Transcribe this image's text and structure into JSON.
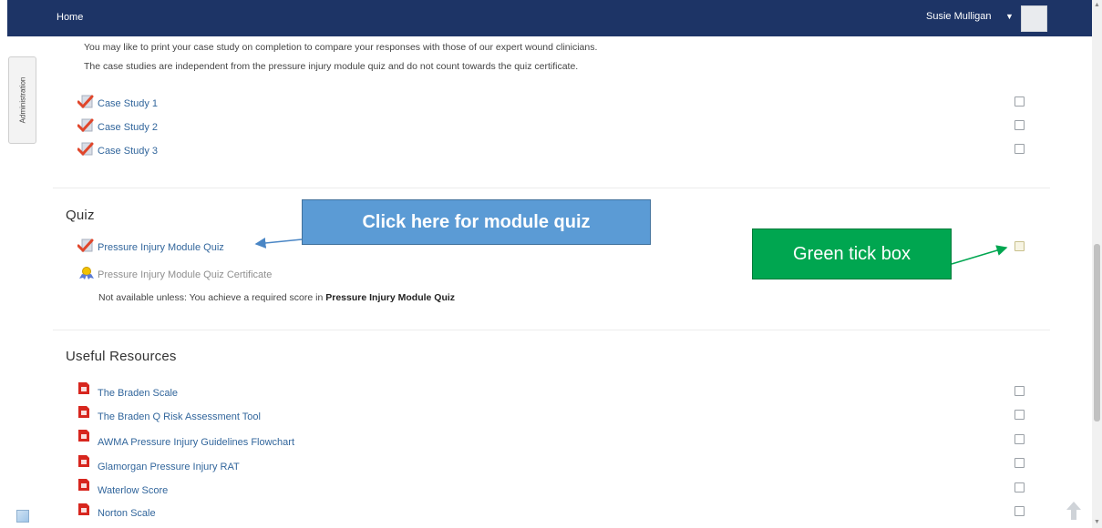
{
  "nav": {
    "home": "Home",
    "user": "Susie Mulligan",
    "caret": "▼"
  },
  "admin_tab": "Administration",
  "intro": {
    "line1": "You may like to print your case study on completion to compare your responses with those of our expert wound clinicians.",
    "line2": "The case studies are independent from the pressure injury module quiz and do not count towards the quiz certificate."
  },
  "case_studies": [
    {
      "label": "Case Study 1",
      "icon": "quiz-check-icon"
    },
    {
      "label": "Case Study 2",
      "icon": "quiz-check-icon"
    },
    {
      "label": "Case Study 3",
      "icon": "quiz-check-icon"
    }
  ],
  "quiz": {
    "title": "Quiz",
    "module_quiz": "Pressure Injury Module Quiz",
    "certificate": "Pressure Injury Module Quiz Certificate",
    "restriction_prefix": "Not available unless: You achieve a required score in",
    "restriction_target": "Pressure Injury Module Quiz"
  },
  "annotations": {
    "quiz_callout": "Click here for module quiz",
    "tick_callout": "Green tick box"
  },
  "resources": {
    "title": "Useful Resources",
    "items": [
      {
        "label": "The Braden Scale",
        "icon": "pdf-icon"
      },
      {
        "label": "The Braden Q Risk Assessment Tool",
        "icon": "pdf-icon"
      },
      {
        "label": "AWMA Pressure Injury Guidelines Flowchart",
        "icon": "pdf-icon"
      },
      {
        "label": "Glamorgan Pressure Injury RAT",
        "icon": "pdf-icon"
      },
      {
        "label": "Waterlow Score",
        "icon": "pdf-icon"
      },
      {
        "label": "Norton Scale",
        "icon": "pdf-icon"
      }
    ]
  },
  "colors": {
    "nav_bg": "#1d3466",
    "link": "#32669c",
    "callout_blue": "#5b9bd5",
    "callout_green": "#00a650"
  }
}
